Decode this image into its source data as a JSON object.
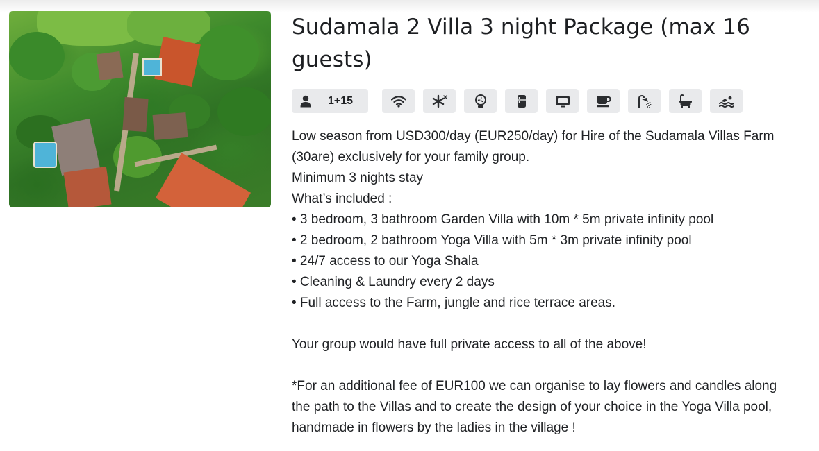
{
  "listing": {
    "title": "Sudamala 2 Villa 3 night Package (max 16 guests)",
    "guests": "1+15",
    "amenity_icons": [
      "wifi-icon",
      "air-conditioning-icon",
      "fan-icon",
      "fridge-icon",
      "tv-icon",
      "coffee-icon",
      "shower-icon",
      "bathtub-icon",
      "swimming-pool-icon"
    ],
    "description": {
      "line1": "Low season from USD300/day (EUR250/day) for Hire of the Sudamala Villas Farm",
      "line2": "(30are) exclusively for your family group.",
      "line3": "Minimum 3 nights stay",
      "line4": "What’s included :",
      "bullet1": "• 3 bedroom, 3 bathroom Garden Villa with 10m * 5m private infinity pool",
      "bullet2": "• 2 bedroom, 2 bathroom Yoga Villa with 5m * 3m private infinity pool",
      "bullet3": "• 24/7 access to our Yoga Shala",
      "bullet4": "• Cleaning & Laundry every 2 days",
      "bullet5": "• Full access to the Farm, jungle and rice terrace areas.",
      "paragraph2": "Your group would have full private access to all of the above!",
      "note1": "*For an additional fee of EUR100 we can organise to lay flowers and candles along",
      "note2": "the path to the Villas and to create the design of your choice in the Yoga Villa pool,",
      "note3": "handmade in flowers by the ladies in the village !"
    }
  }
}
